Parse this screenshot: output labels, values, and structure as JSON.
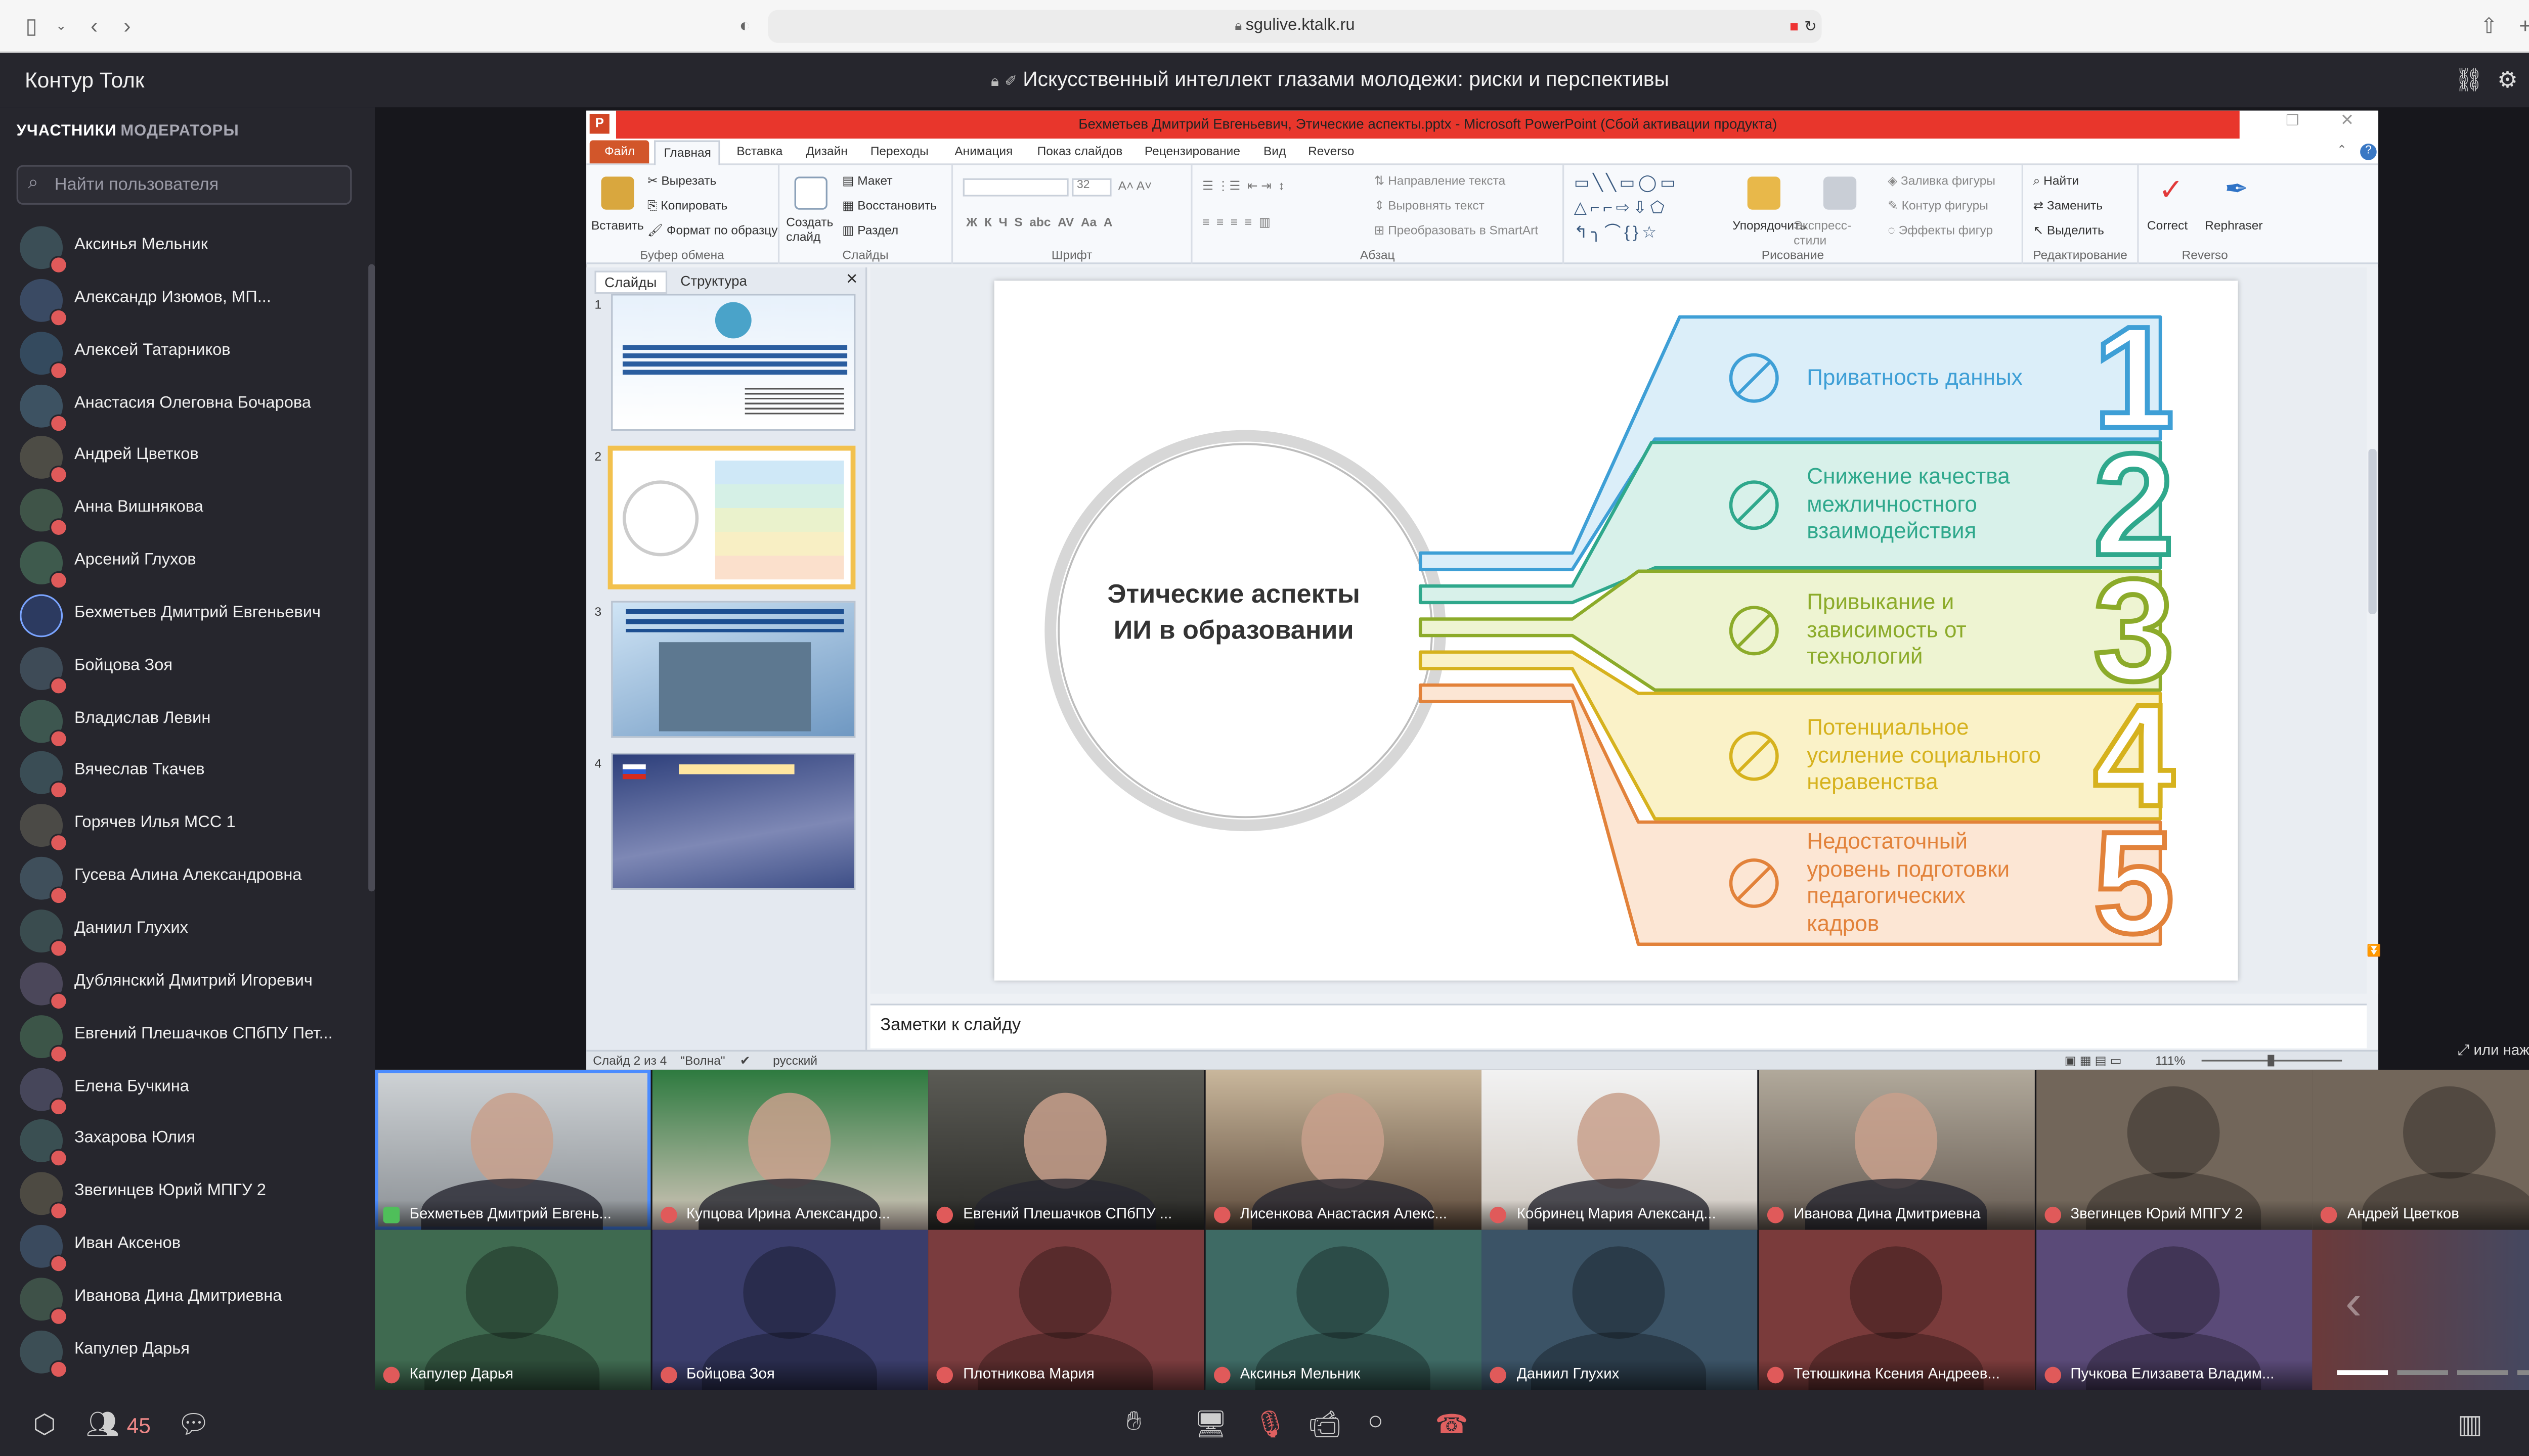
{
  "browser": {
    "url": "sgulive.ktalk.ru"
  },
  "app": {
    "name": "Контур Толк",
    "meeting_title": "Искусственный интеллект глазами молодежи: риски и перспективы",
    "fullscreen_hint": "или нажмите F"
  },
  "sidebar": {
    "tabs": [
      "УЧАСТНИКИ",
      "МОДЕРАТОРЫ"
    ],
    "search_placeholder": "Найти пользователя",
    "participants": [
      "Аксинья Мельник",
      "Александр Изюмов, МП...",
      "Алексей Татарников",
      "Анастасия Олеговна Бочарова",
      "Андрей Цветков",
      "Анна Вишнякова",
      "Арсений Глухов",
      "Бехметьев Дмитрий Евгеньевич",
      "Бойцова Зоя",
      "Владислав Левин",
      "Вячеслав Ткачев",
      "Горячев Илья МСС 1",
      "Гусева Алина Александровна",
      "Даниил Глухих",
      "Дублянский Дмитрий Игоревич",
      "Евгений Плешачков СПбПУ Пет...",
      "Елена Бучкина",
      "Захарова Юлия",
      "Звегинцев Юрий МПГУ 2",
      "Иван Аксенов",
      "Иванова Дина Дмитриевна",
      "Капулер Дарья"
    ]
  },
  "ppt": {
    "window_title": "Бехметьев Дмитрий Евгеньевич, Этические аспекты.pptx - Microsoft PowerPoint (Сбой активации продукта)",
    "menu": [
      "Файл",
      "Главная",
      "Вставка",
      "Дизайн",
      "Переходы",
      "Анимация",
      "Показ слайдов",
      "Рецензирование",
      "Вид",
      "Reverso"
    ],
    "ribbon": {
      "paste": "Вставить",
      "cut": "Вырезать",
      "copy": "Копировать",
      "format_painter": "Формат по образцу",
      "clipboard": "Буфер обмена",
      "create_slide": "Создать слайд",
      "layout": "Макет",
      "reset": "Восстановить",
      "section": "Раздел",
      "slides": "Слайды",
      "font": "Шрифт",
      "font_size": "32",
      "paragraph": "Абзац",
      "text_direction": "Направление текста",
      "align_text": "Выровнять текст",
      "smartart": "Преобразовать в SmartArt",
      "arrange": "Упорядочить",
      "quick_styles": "Экспресс-стили",
      "shape_fill": "Заливка фигуры",
      "shape_outline": "Контур фигуры",
      "shape_effects": "Эффекты фигур",
      "drawing": "Рисование",
      "find": "Найти",
      "replace": "Заменить",
      "select": "Выделить",
      "editing": "Редактирование",
      "correct": "Correct",
      "rephraser": "Rephraser",
      "reverso": "Reverso"
    },
    "panel_tabs": [
      "Слайды",
      "Структура"
    ],
    "slide": {
      "center": "Этические аспекты ИИ в образовании",
      "items": [
        {
          "num": "1",
          "text": [
            "Приватность данных"
          ],
          "color": "#3e9fd6",
          "fill": "#dbeef9"
        },
        {
          "num": "2",
          "text": [
            "Снижение качества",
            "межличностного",
            "взаимодействия"
          ],
          "color": "#2fa88c",
          "fill": "#d8f1ea"
        },
        {
          "num": "3",
          "text": [
            "Привыкание и",
            "зависимость от",
            "технологий"
          ],
          "color": "#8cab2a",
          "fill": "#eef4d2"
        },
        {
          "num": "4",
          "text": [
            "Потенциальное",
            "усиление социального",
            "неравенства"
          ],
          "color": "#d6b21e",
          "fill": "#faf2c8"
        },
        {
          "num": "5",
          "text": [
            "Недостаточный",
            "уровень подготовки",
            "педагогических",
            "кадров"
          ],
          "color": "#e2823a",
          "fill": "#fce6d4"
        }
      ]
    },
    "notes": "Заметки к слайду",
    "status": {
      "slide": "Слайд 2 из 4",
      "theme": "\"Волна\"",
      "lang": "русский",
      "zoom": "111%"
    }
  },
  "video": {
    "top": [
      "Бехметьев Дмитрий Евгень...",
      "Купцова Ирина Александро...",
      "Евгений Плешачков СПбПУ ...",
      "Лисенкова Анастасия Алекс...",
      "Кобринец Мария Александ...",
      "Иванова Дина Дмитриевна",
      "Звегинцев Юрий МПГУ 2",
      "Андрей Цветков"
    ],
    "bottom": [
      "Капулер Дарья",
      "Бойцова Зоя",
      "Плотникова Мария",
      "Аксинья Мельник",
      "Даниил Глухих",
      "Тетюшкина Ксения Андреев...",
      "Пучкова Елизавета Владим..."
    ]
  },
  "bottom": {
    "participant_count": "45"
  }
}
